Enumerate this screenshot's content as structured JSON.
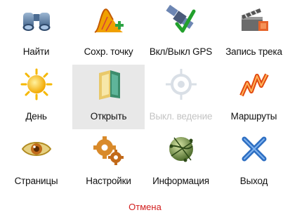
{
  "menu": {
    "items": [
      {
        "label": "Найти",
        "icon": "binoculars-icon"
      },
      {
        "label": "Сохр. точку",
        "icon": "save-point-icon"
      },
      {
        "label": "Вкл/Выкл GPS",
        "icon": "satellite-icon"
      },
      {
        "label": "Запись трека",
        "icon": "clapperboard-icon"
      },
      {
        "label": "День",
        "icon": "sun-icon"
      },
      {
        "label": "Открыть",
        "icon": "open-book-icon"
      },
      {
        "label": "Выкл. ведение",
        "icon": "crosshair-icon"
      },
      {
        "label": "Маршруты",
        "icon": "route-icon"
      },
      {
        "label": "Страницы",
        "icon": "eye-icon"
      },
      {
        "label": "Настройки",
        "icon": "gears-icon"
      },
      {
        "label": "Информация",
        "icon": "globe-icon"
      },
      {
        "label": "Выход",
        "icon": "close-icon"
      }
    ],
    "selected_label": "Открыть",
    "disabled_label": "Выкл. ведение"
  },
  "cancel_label": "Отмена",
  "colors": {
    "cancel": "#d21f1f",
    "disabled_text": "#c4c4c4",
    "selected_bg": "#e8e8e8"
  }
}
